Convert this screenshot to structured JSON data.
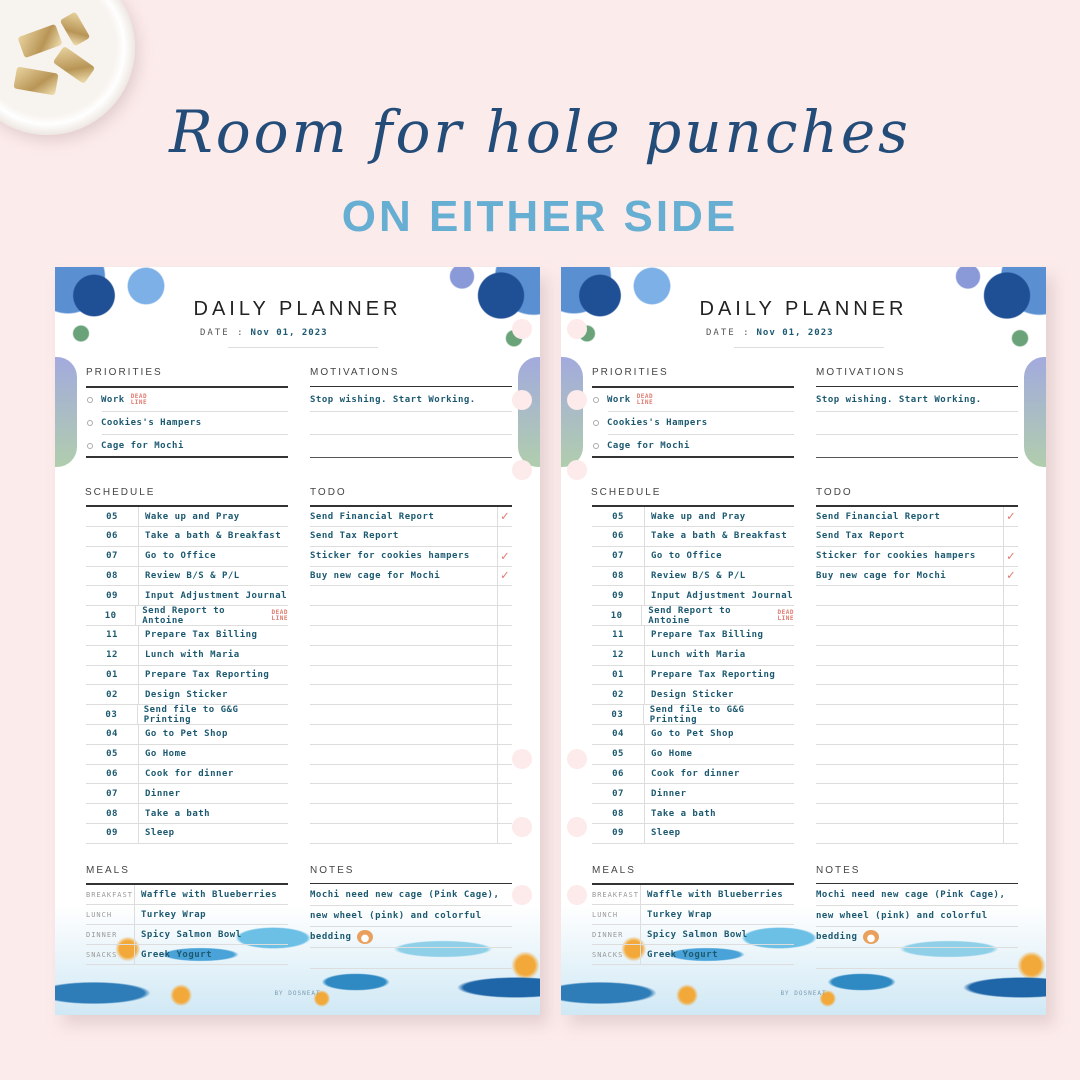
{
  "headline": {
    "script": "Room for hole punches",
    "sub": "ON EITHER SIDE"
  },
  "colors": {
    "background": "#fcebeb",
    "script": "#244c78",
    "sub": "#67aed3",
    "entry_text": "#1c5970",
    "check": "#e07a6e"
  },
  "planner": {
    "title": "DAILY PLANNER",
    "date_label": "DATE :",
    "date_value": "Nov 01, 2023",
    "priorities": {
      "heading": "PRIORITIES",
      "items": [
        {
          "text": "Work",
          "sticker": [
            "DEAD",
            "LINE"
          ]
        },
        {
          "text": "Cookies's Hampers",
          "sticker": null
        },
        {
          "text": "Cage for Mochi",
          "sticker": null
        }
      ]
    },
    "motivations": {
      "heading": "MOTIVATIONS",
      "items": [
        "Stop wishing. Start Working.",
        "",
        ""
      ]
    },
    "schedule": {
      "heading": "SCHEDULE",
      "rows": [
        {
          "hour": "05",
          "task": "Wake up and Pray"
        },
        {
          "hour": "06",
          "task": "Take a bath & Breakfast"
        },
        {
          "hour": "07",
          "task": "Go to Office"
        },
        {
          "hour": "08",
          "task": "Review B/S & P/L"
        },
        {
          "hour": "09",
          "task": "Input Adjustment Journal"
        },
        {
          "hour": "10",
          "task": "Send Report to Antoine",
          "sticker": [
            "DEAD",
            "LINE"
          ]
        },
        {
          "hour": "11",
          "task": "Prepare Tax Billing"
        },
        {
          "hour": "12",
          "task": "Lunch with Maria"
        },
        {
          "hour": "01",
          "task": "Prepare Tax Reporting"
        },
        {
          "hour": "02",
          "task": "Design Sticker"
        },
        {
          "hour": "03",
          "task": "Send file to G&G Printing"
        },
        {
          "hour": "04",
          "task": "Go to Pet Shop"
        },
        {
          "hour": "05",
          "task": "Go Home"
        },
        {
          "hour": "06",
          "task": "Cook for dinner"
        },
        {
          "hour": "07",
          "task": "Dinner"
        },
        {
          "hour": "08",
          "task": "Take a bath"
        },
        {
          "hour": "09",
          "task": "Sleep"
        }
      ]
    },
    "todo": {
      "heading": "TODO",
      "items": [
        {
          "text": "Send Financial Report",
          "done": true
        },
        {
          "text": "Send Tax Report",
          "done": false
        },
        {
          "text": "Sticker for cookies hampers",
          "done": true
        },
        {
          "text": "Buy new cage for Mochi",
          "done": true
        }
      ],
      "check_glyph": "✓",
      "total_rows": 17
    },
    "meals": {
      "heading": "MEALS",
      "rows": [
        {
          "label": "BREAKFAST",
          "value": "Waffle with Blueberries"
        },
        {
          "label": "LUNCH",
          "value": "Turkey Wrap"
        },
        {
          "label": "DINNER",
          "value": "Spicy Salmon Bowl"
        },
        {
          "label": "SNACKS",
          "value": "Greek Yogurt"
        }
      ]
    },
    "notes": {
      "heading": "NOTES",
      "lines": [
        "Mochi need new cage (Pink Cage),",
        "new wheel (pink) and colorful",
        "bedding",
        ""
      ]
    },
    "credit": "BY DOSNEAT"
  },
  "pages": [
    {
      "name": "left-page",
      "holes_side": "right"
    },
    {
      "name": "right-page",
      "holes_side": "left"
    }
  ]
}
